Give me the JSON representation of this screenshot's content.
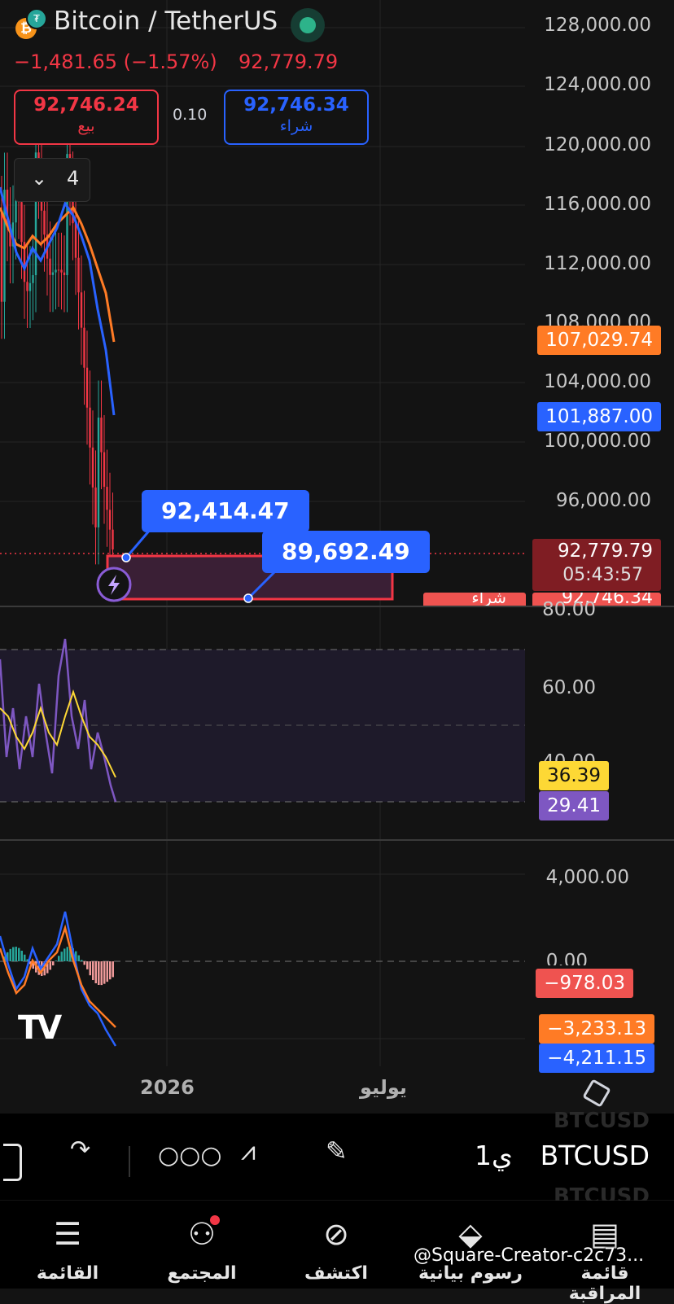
{
  "header": {
    "symbol_title": "Bitcoin / TetherUS",
    "change": "−1,481.65 (−1.57%)",
    "last_price": "92,779.79",
    "coin_icon": "bitcoin-icon",
    "quote_icon": "tether-icon"
  },
  "quick_trade": {
    "sell_price": "92,746.24",
    "sell_label": "بيع",
    "spread": "0.10",
    "buy_price": "92,746.34",
    "buy_label": "شراء"
  },
  "indicators_toggle": {
    "icon": "chevron-down-icon",
    "count": "4"
  },
  "price_axis": {
    "ticks": [
      "128,000.00",
      "124,000.00",
      "120,000.00",
      "116,000.00",
      "112,000.00",
      "108,000.00",
      "104,000.00",
      "100,000.00",
      "96,000.00",
      "80.00"
    ]
  },
  "price_tags": {
    "ema_orange": "107,029.74",
    "ema_blue": "101,887.00",
    "last": "92,779.79",
    "countdown": "05:43:57",
    "buy_line": "92,746.34",
    "buy_line_label": "شراء"
  },
  "callouts": {
    "high": "92,414.47",
    "low": "89,692.49"
  },
  "rsi_axis": {
    "ticks": [
      "60.00",
      "40.00"
    ],
    "signal": "36.39",
    "rsi": "29.41"
  },
  "macd_axis": {
    "ticks": [
      "4,000.00",
      "0.00"
    ],
    "hist": "−978.03",
    "signal": "−3,233.13",
    "macd": "−4,211.15"
  },
  "time_axis": {
    "year": "2026",
    "month": "يوليو"
  },
  "toolbar": {
    "symbol": "BTCUSD",
    "interval": "1ي",
    "ghost_symbol": "BTCUSD"
  },
  "nav": {
    "items": [
      {
        "label": "القائمة",
        "icon": "menu-icon"
      },
      {
        "label": "المجتمع",
        "icon": "community-icon"
      },
      {
        "label": "اكتشف",
        "icon": "compass-icon"
      },
      {
        "label": "رسوم بيانية",
        "icon": "chart-icon"
      },
      {
        "label": "قائمة المراقبة",
        "icon": "watchlist-icon"
      }
    ]
  },
  "watermark": "@Square-Creator-c2c73...",
  "colors": {
    "up": "#26a69a",
    "down": "#f23645",
    "ema_orange": "#ff7b25",
    "ema_blue": "#2962ff",
    "rsi": "#7e57c2",
    "rsi_signal": "#fdd835",
    "macd_hist_label": "#ef5350"
  },
  "chart_data": {
    "type": "line",
    "price": {
      "close_approx": [
        114000,
        110000,
        117000,
        112000,
        116000,
        113000,
        111000,
        114000,
        116000,
        112000,
        108000,
        103000,
        98000,
        94000,
        92780
      ]
    },
    "rsi": {
      "values": [
        60,
        45,
        52,
        38,
        62,
        42,
        55,
        70,
        40,
        48,
        35,
        42,
        30,
        29
      ],
      "signal": [
        50,
        48,
        46,
        48,
        52,
        50,
        54,
        56,
        46,
        44,
        40,
        38,
        37,
        36
      ]
    },
    "macd": {
      "values": [
        500,
        -200,
        800,
        -600,
        1500,
        -300,
        1200,
        2800,
        400,
        -800,
        -2000,
        -3000,
        -3800,
        -4211
      ],
      "signal": [
        200,
        0,
        300,
        -200,
        700,
        200,
        800,
        1600,
        900,
        200,
        -800,
        -1800,
        -2700,
        -3233
      ]
    }
  }
}
